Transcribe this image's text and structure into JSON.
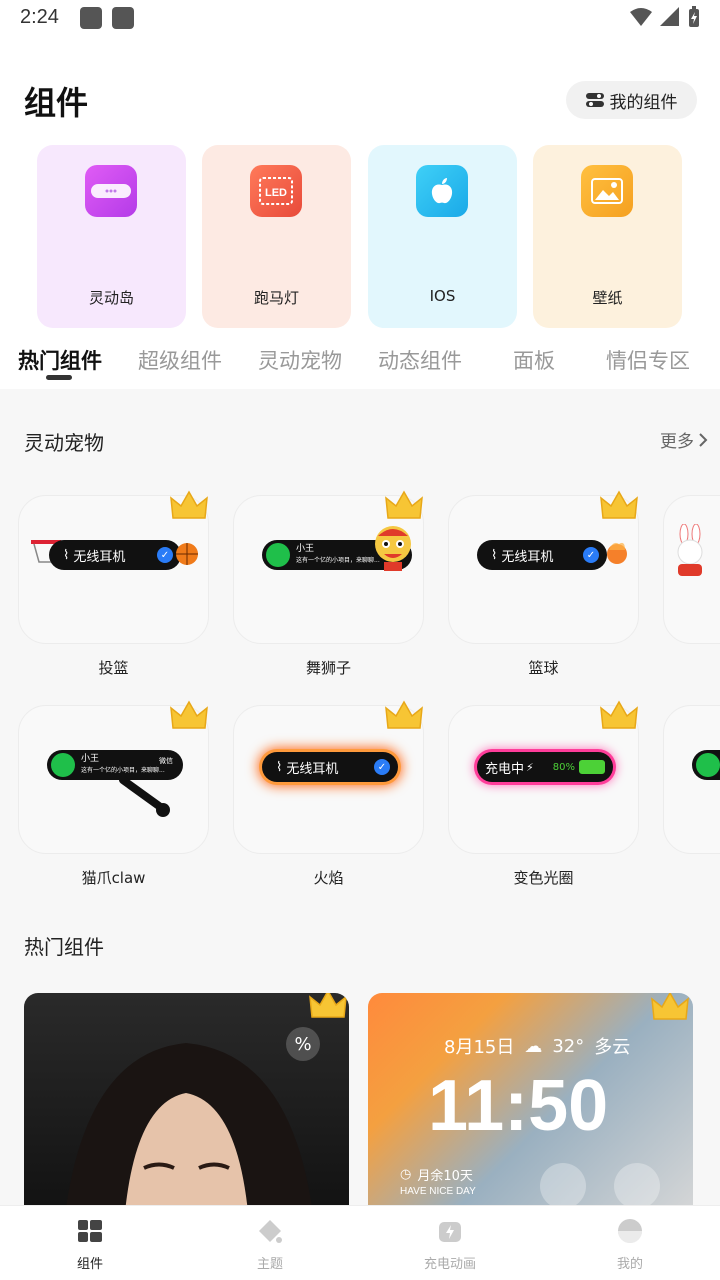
{
  "status": {
    "time": "2:24"
  },
  "header": {
    "title": "组件",
    "my_widgets": "我的组件"
  },
  "categories": [
    {
      "label": "灵动岛",
      "bg": "#f7e8fd",
      "icon": "dynamic-island-icon"
    },
    {
      "label": "跑马灯",
      "bg": "#fdeae3",
      "icon": "led-icon"
    },
    {
      "label": "IOS",
      "bg": "#e2f7fd",
      "icon": "apple-icon"
    },
    {
      "label": "壁纸",
      "bg": "#fdf1dd",
      "icon": "image-icon"
    }
  ],
  "tabs": [
    "热门组件",
    "超级组件",
    "灵动宠物",
    "动态组件",
    "面板",
    "情侣专区"
  ],
  "pets_section": {
    "title": "灵动宠物",
    "more": "更多",
    "items": [
      {
        "label": "投篮",
        "pill_text": "无线耳机"
      },
      {
        "label": "舞狮子",
        "pill_name": "小王",
        "pill_msg": "这有一个亿的小项目，来聊聊..."
      },
      {
        "label": "篮球",
        "pill_text": "无线耳机"
      },
      {
        "label": "猫爪claw",
        "pill_name": "小王",
        "pill_msg": "这有一个亿的小项目，来聊聊...",
        "pill_tag": "微信"
      },
      {
        "label": "火焰",
        "pill_text": "无线耳机"
      },
      {
        "label": "变色光圈",
        "pill_text": "充电中",
        "battery": "80%"
      }
    ]
  },
  "hot_section": {
    "title": "热门组件",
    "card2": {
      "date": "8月15日",
      "temp": "32°",
      "weather": "多云",
      "time": "11:50",
      "remain": "月余10天",
      "tagline": "HAVE NICE DAY"
    }
  },
  "bottom_nav": [
    {
      "label": "组件",
      "icon": "widgets-icon",
      "active": true
    },
    {
      "label": "主题",
      "icon": "theme-icon",
      "active": false
    },
    {
      "label": "充电动画",
      "icon": "charge-icon",
      "active": false
    },
    {
      "label": "我的",
      "icon": "profile-icon",
      "active": false
    }
  ]
}
